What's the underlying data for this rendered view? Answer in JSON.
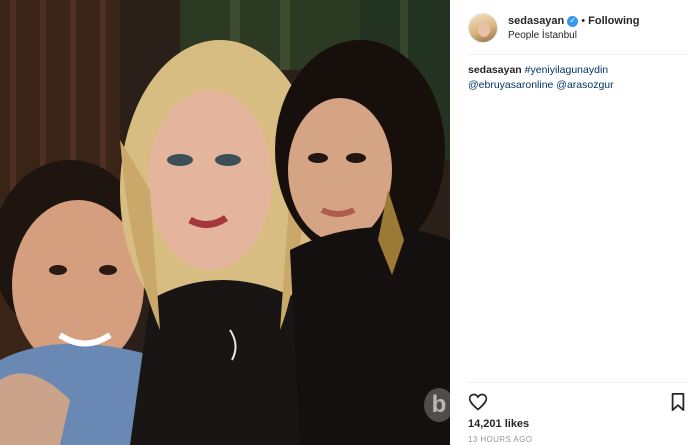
{
  "post": {
    "username": "sedasayan",
    "follow_status": "Following",
    "separator": "•",
    "location": "People İstanbul",
    "caption": {
      "user": "sedasayan",
      "hashtag": "#yeniyilagunaydin",
      "mention1": "@ebruyasaronline",
      "mention2": "@arasozgur"
    },
    "likes": "14,201 likes",
    "time": "13 HOURS AGO"
  },
  "photo": {
    "watermark_letter": "b"
  },
  "icons": [
    "verified-icon",
    "heart-icon",
    "bookmark-icon"
  ],
  "colors": {
    "link": "#003569",
    "verified": "#3897f0",
    "divider": "#efefef",
    "timestamp": "#999999"
  }
}
